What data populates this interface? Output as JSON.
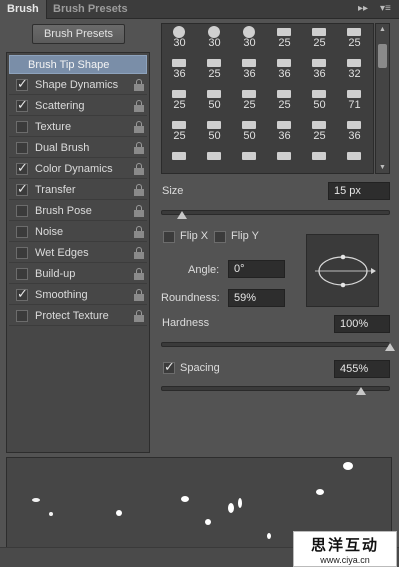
{
  "tabs": {
    "active": "Brush",
    "inactive": "Brush Presets"
  },
  "buttons": {
    "brush_presets": "Brush Presets"
  },
  "options": [
    {
      "label": "Brush Tip Shape",
      "header": true
    },
    {
      "label": "Shape Dynamics",
      "checked": true,
      "lock": true
    },
    {
      "label": "Scattering",
      "checked": true,
      "lock": true
    },
    {
      "label": "Texture",
      "checked": false,
      "lock": true
    },
    {
      "label": "Dual Brush",
      "checked": false,
      "lock": true
    },
    {
      "label": "Color Dynamics",
      "checked": true,
      "lock": true
    },
    {
      "label": "Transfer",
      "checked": true,
      "lock": true
    },
    {
      "label": "Brush Pose",
      "checked": false,
      "lock": true
    },
    {
      "label": "Noise",
      "checked": false,
      "lock": true
    },
    {
      "label": "Wet Edges",
      "checked": false,
      "lock": true
    },
    {
      "label": "Build-up",
      "checked": false,
      "lock": true
    },
    {
      "label": "Smoothing",
      "checked": true,
      "lock": true
    },
    {
      "label": "Protect Texture",
      "checked": false,
      "lock": true
    }
  ],
  "tip_sizes": [
    [
      "30",
      "30",
      "30",
      "25",
      "25",
      "25"
    ],
    [
      "36",
      "25",
      "36",
      "36",
      "36",
      "32"
    ],
    [
      "25",
      "50",
      "25",
      "25",
      "50",
      "71"
    ],
    [
      "25",
      "50",
      "50",
      "36",
      "25",
      "36"
    ],
    [
      "",
      "",
      "",
      "",
      "",
      ""
    ]
  ],
  "size": {
    "label": "Size",
    "value": "15 px",
    "slider_fraction": 0.07
  },
  "flip": {
    "x_label": "Flip X",
    "y_label": "Flip Y",
    "x_checked": false,
    "y_checked": false
  },
  "angle": {
    "label": "Angle:",
    "value": "0°"
  },
  "roundness": {
    "label": "Roundness:",
    "value": "59%"
  },
  "hardness": {
    "label": "Hardness",
    "value": "100%",
    "slider_fraction": 1.0
  },
  "spacing": {
    "label": "Spacing",
    "value": "455%",
    "checked": true,
    "slider_fraction": 0.87
  },
  "watermark": {
    "line1": "思洋互动",
    "line2": "www.ciya.cn"
  },
  "colors": {
    "panel": "#535353",
    "header_highlight": "#7a8ea8",
    "field_bg": "#2d2d2d"
  }
}
